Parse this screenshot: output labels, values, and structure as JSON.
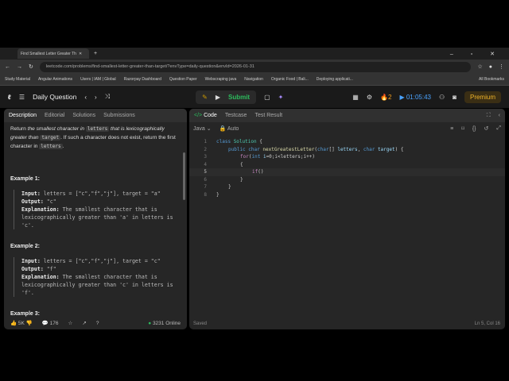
{
  "browser": {
    "tab_title": "Find Smallest Letter Greater Th",
    "url": "leetcode.com/problems/find-smallest-letter-greater-than-target/?envType=daily-question&envId=2026-01-31",
    "bookmarks": [
      "Study Material",
      "Angular Animations",
      "Users | IAM | Global",
      "Razorpay Dashboard",
      "Question Paper",
      "Webscraping java",
      "Navigation",
      "Organic Food | Bali...",
      "Deploying applicati..."
    ],
    "all_bookmarks": "All Bookmarks"
  },
  "nav": {
    "title": "Daily Question",
    "submit": "Submit",
    "streak": "2",
    "timer": "01:05:43",
    "premium": "Premium"
  },
  "left": {
    "tabs": [
      "Description",
      "Editorial",
      "Solutions",
      "Submissions"
    ],
    "desc": {
      "t1": "Return ",
      "t2": "the smallest character in ",
      "c1": "letters",
      "t3": " that is lexicographically greater than ",
      "c2": "target",
      "t4": ". If such a character does not exist, return the first character in ",
      "c3": "letters",
      "t5": "."
    },
    "examples": [
      {
        "title": "Example 1:",
        "input_label": "Input:",
        "input": " letters = [\"c\",\"f\",\"j\"], target = \"a\"",
        "output_label": "Output:",
        "output": " \"c\"",
        "expl_label": "Explanation:",
        "expl": " The smallest character that is lexicographically greater than 'a' in letters is 'c'."
      },
      {
        "title": "Example 2:",
        "input_label": "Input:",
        "input": " letters = [\"c\",\"f\",\"j\"], target = \"c\"",
        "output_label": "Output:",
        "output": " \"f\"",
        "expl_label": "Explanation:",
        "expl": " The smallest character that is lexicographically greater than 'c' in letters is 'f'."
      }
    ],
    "example3": "Example 3:",
    "footer": {
      "likes": "5K",
      "comments": "176",
      "online": "3231 Online"
    }
  },
  "right": {
    "tabs": [
      "Code",
      "Testcase",
      "Test Result"
    ],
    "language": "Java",
    "mode": "Auto",
    "status": "Saved",
    "cursor": "Ln 5, Col 16"
  }
}
